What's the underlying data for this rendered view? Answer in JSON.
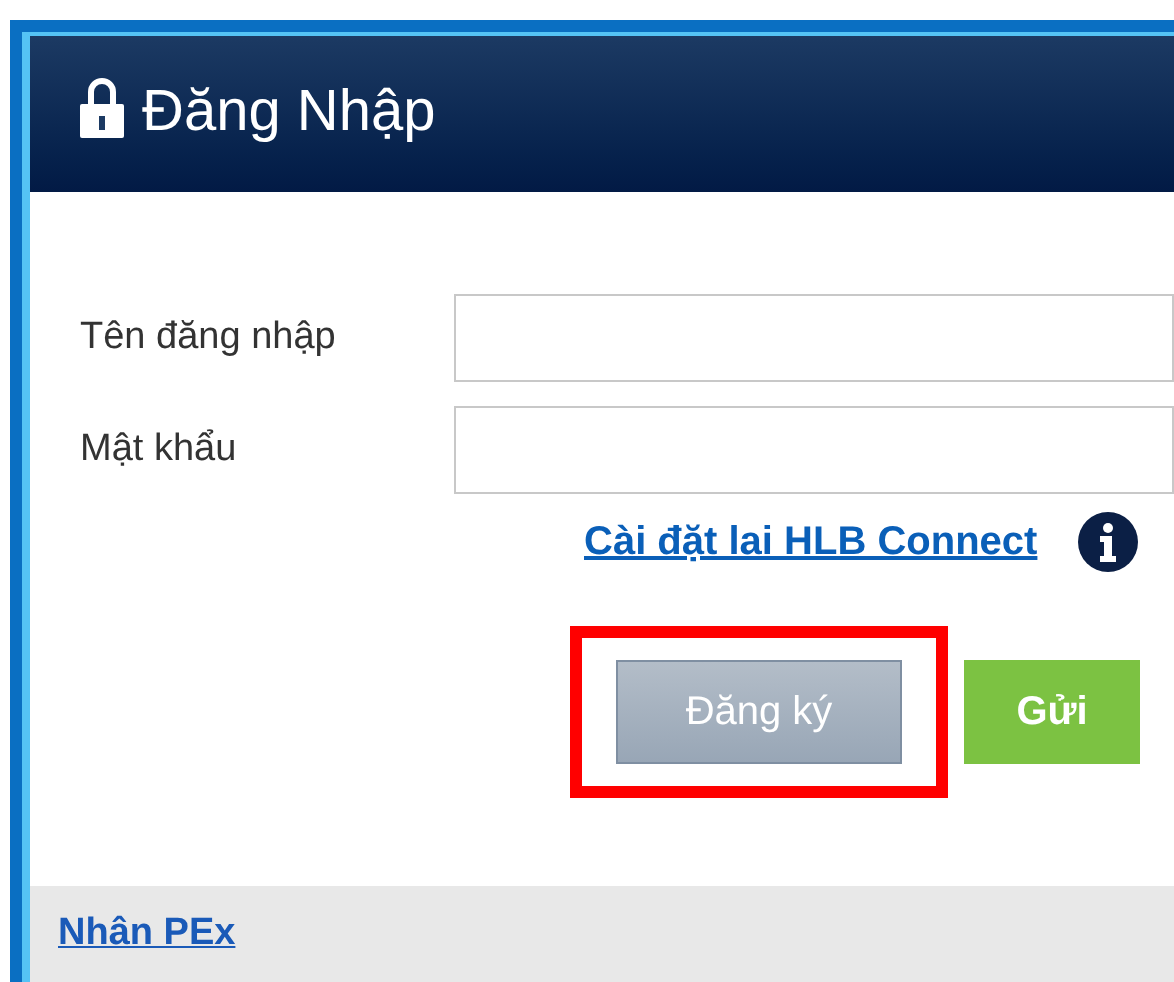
{
  "header": {
    "title": "Đăng Nhập"
  },
  "fields": [
    {
      "label": "Tên đăng nhập"
    },
    {
      "label": "Mật khẩu"
    }
  ],
  "reset_link": "Cài đặt lai HLB Connect",
  "buttons": [
    {
      "label": "Đăng ký",
      "kind": "secondary",
      "highlighted": true
    },
    {
      "label": "Gửi",
      "kind": "primary",
      "highlighted": false
    }
  ],
  "footer_link": "Nhân PEx"
}
